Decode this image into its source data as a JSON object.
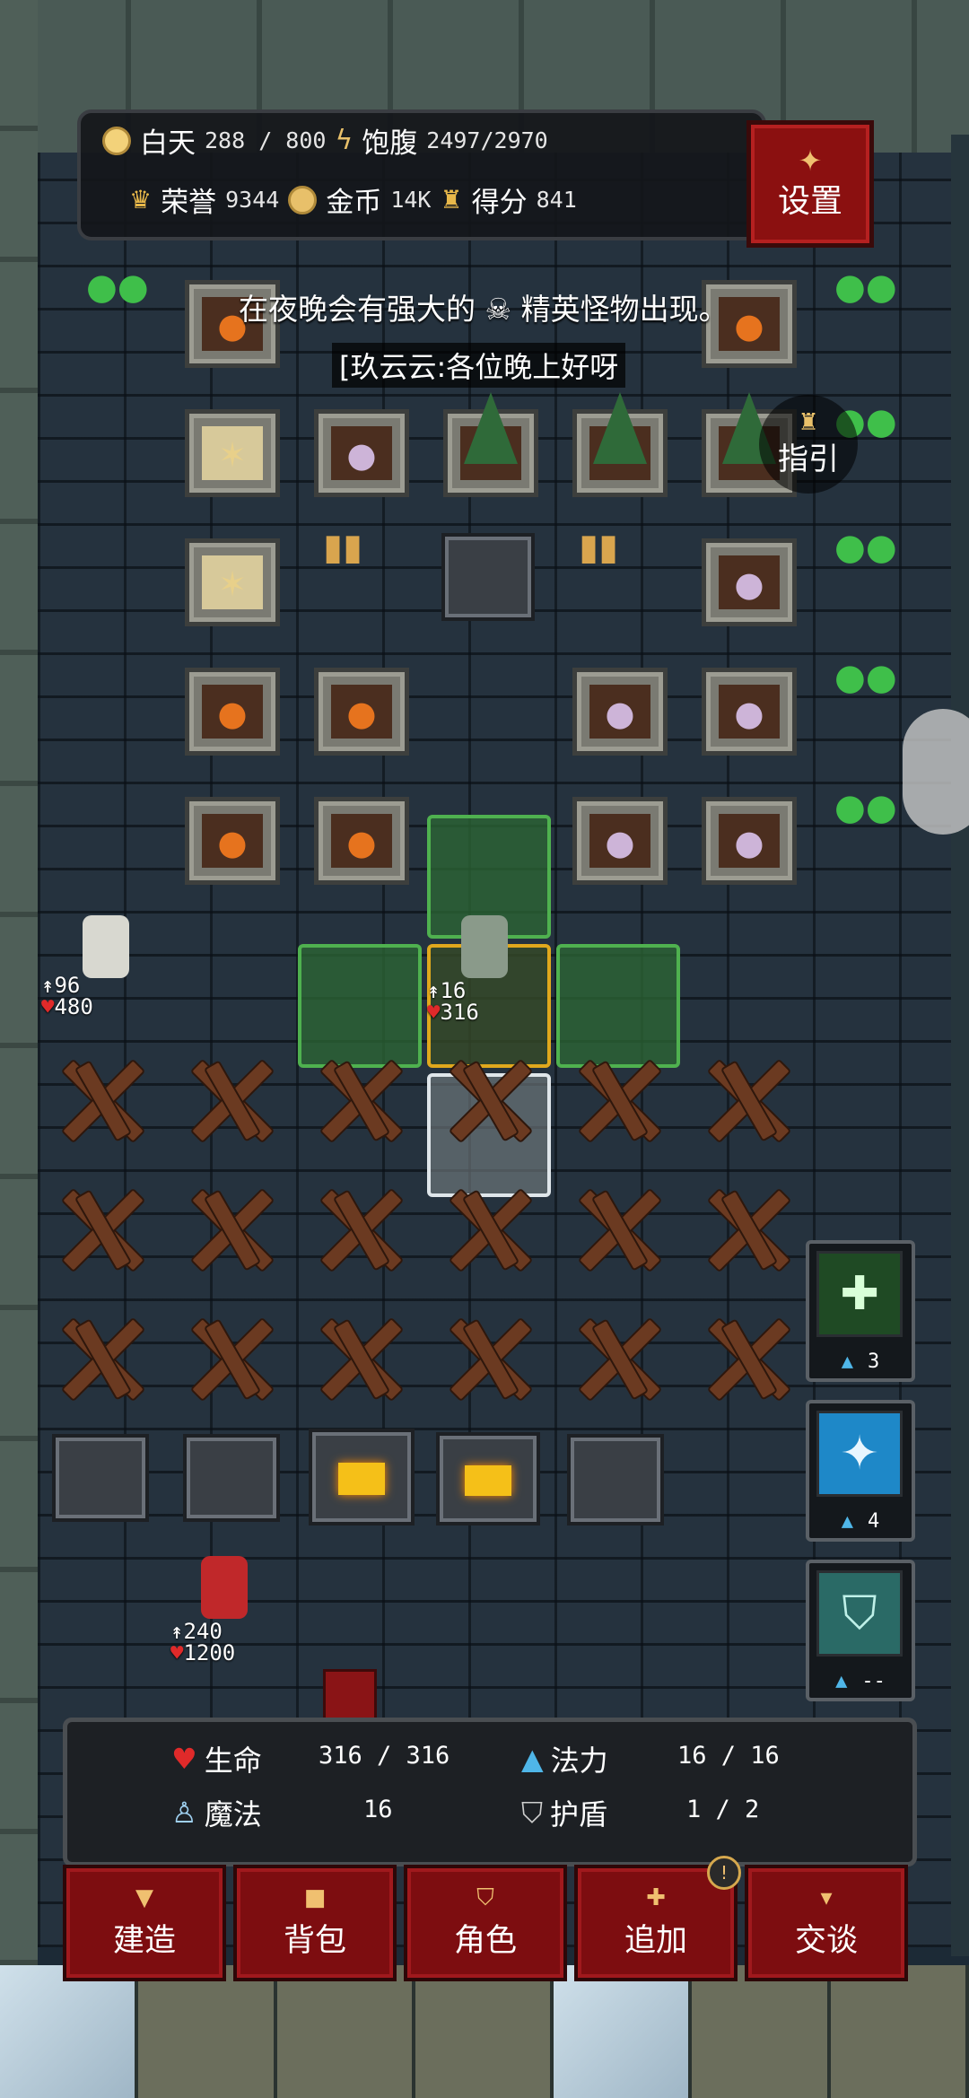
{
  "status": {
    "day_label": "白天",
    "day_value": "288 / 800",
    "hunger_label": "饱腹",
    "hunger_value": "2497/2970",
    "honor_label": "荣誉",
    "honor_value": "9344",
    "gold_label": "金币",
    "gold_value": "14K",
    "score_label": "得分",
    "score_value": "841"
  },
  "settings_label": "设置",
  "guide_label": "指引",
  "announcement": "在夜晚会有强大的 ☠ 精英怪物出现。",
  "chat_message": "[玖云云:各位晚上好呀",
  "player": {
    "stat_top": "16",
    "hp": "316"
  },
  "npc_elder": {
    "stat_top": "96",
    "hp": "480"
  },
  "npc_red": {
    "stat_top": "240",
    "hp": "1200"
  },
  "skills": [
    {
      "icon": "cross-skill-icon",
      "count": "3"
    },
    {
      "icon": "wind-skill-icon",
      "count": "4"
    },
    {
      "icon": "shield-skill-icon",
      "count": "--"
    }
  ],
  "info": {
    "hp_label": "生命",
    "hp_value": "316 / 316",
    "mana_label": "法力",
    "mana_value": "16 / 16",
    "magic_label": "魔法",
    "magic_value": "16",
    "shield_label": "护盾",
    "shield_value": "1 / 2"
  },
  "actions": [
    {
      "label": "建造",
      "icon": "hammer-icon"
    },
    {
      "label": "背包",
      "icon": "bag-icon"
    },
    {
      "label": "角色",
      "icon": "shield-icon"
    },
    {
      "label": "追加",
      "icon": "plus-icon"
    },
    {
      "label": "交谈",
      "icon": "speech-icon"
    }
  ],
  "colors": {
    "accent_red": "#7d0d10",
    "highlight_green": "#4fb14f",
    "highlight_yellow": "#e0a81d"
  }
}
